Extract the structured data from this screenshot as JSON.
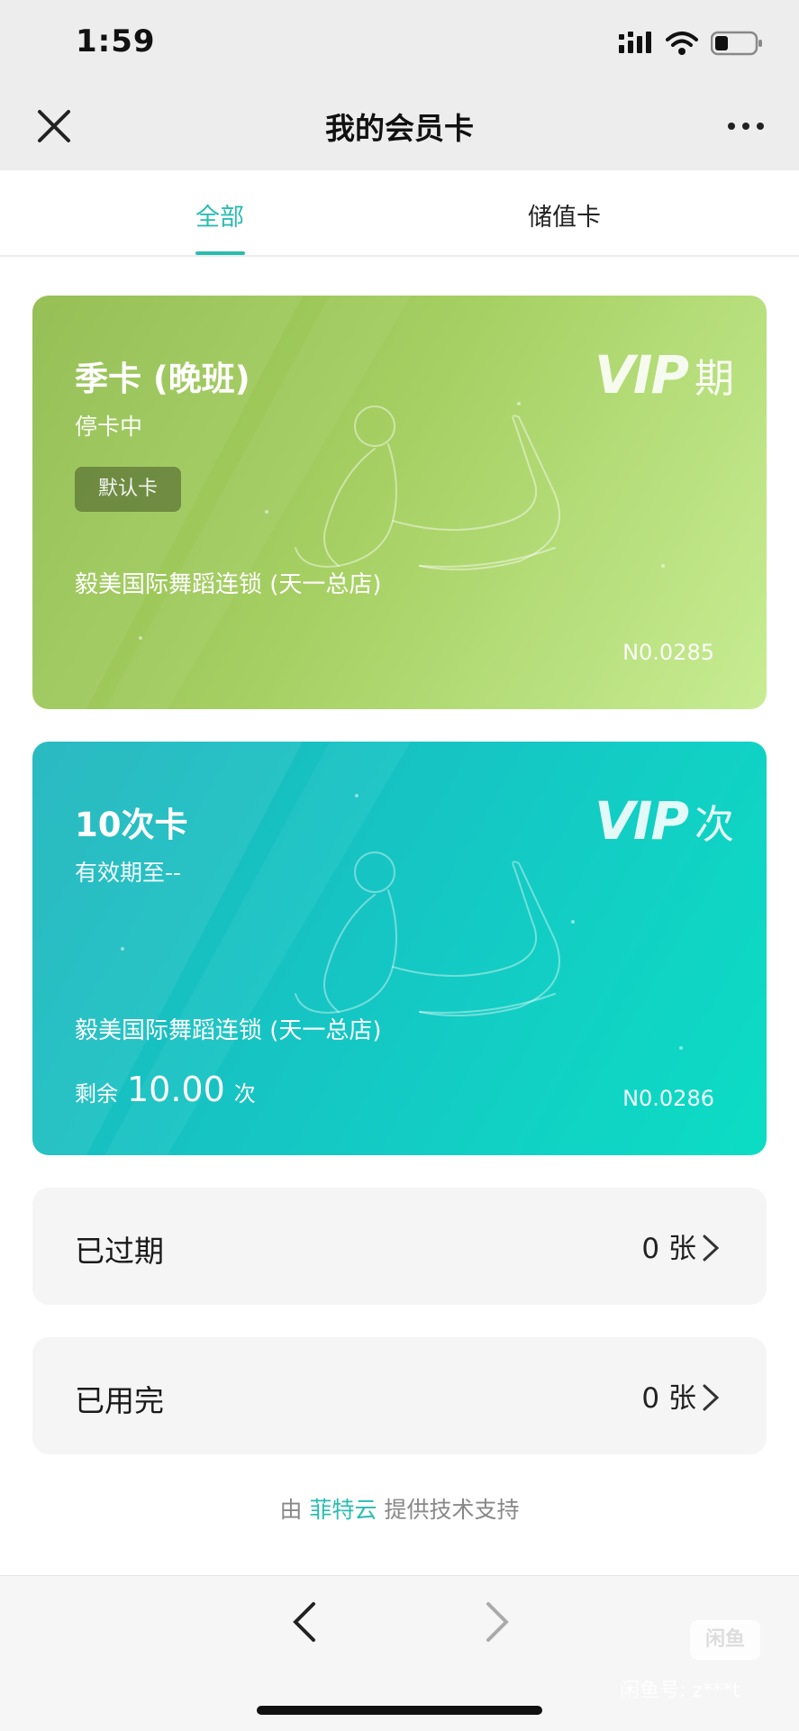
{
  "status_bar": {
    "time": "1:59"
  },
  "nav": {
    "title": "我的会员卡"
  },
  "tabs": [
    {
      "label": "全部",
      "active": true
    },
    {
      "label": "储值卡",
      "active": false
    }
  ],
  "cards": [
    {
      "name": "季卡 (晚班)",
      "status": "停卡中",
      "badge": "默认卡",
      "vip_word": "VIP",
      "vip_kind": "期",
      "store": "毅美国际舞蹈连锁 (天一总店)",
      "number": "N0.0285"
    },
    {
      "name": "10次卡",
      "status": "有效期至--",
      "vip_word": "VIP",
      "vip_kind": "次",
      "store": "毅美国际舞蹈连锁 (天一总店)",
      "remain_prefix": "剩余",
      "remain_value": "10.00",
      "remain_suffix": "次",
      "number": "N0.0286"
    }
  ],
  "rows": [
    {
      "label": "已过期",
      "count": "0 张"
    },
    {
      "label": "已用完",
      "count": "0 张"
    }
  ],
  "support": {
    "prefix": "由",
    "brand": "菲特云",
    "suffix": "提供技术支持"
  },
  "watermark": {
    "logo": "闲鱼",
    "text": "闲鱼号: z***t"
  },
  "colors": {
    "accent": "#2bbcb0",
    "card_green": "#a5cf62",
    "card_teal": "#15c7c4"
  }
}
